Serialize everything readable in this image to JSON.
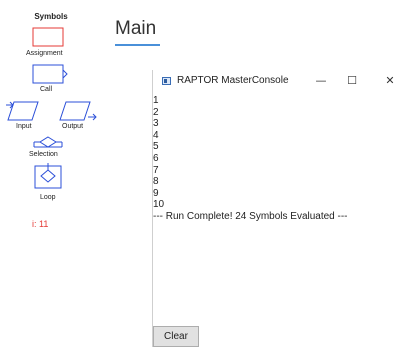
{
  "palette": {
    "title": "Symbols",
    "items": [
      {
        "label": "Assignment",
        "icon": "assignment-rect-icon"
      },
      {
        "label": "Call",
        "icon": "call-arrow-icon"
      },
      {
        "label": "Input",
        "icon": "input-parallelogram-icon"
      },
      {
        "label": "Output",
        "icon": "output-parallelogram-icon"
      },
      {
        "label": "Selection",
        "icon": "selection-diamond-icon"
      },
      {
        "label": "Loop",
        "icon": "loop-diamond-icon"
      }
    ]
  },
  "variables": {
    "readout": "i: 11"
  },
  "main_tab": {
    "label": "Main"
  },
  "console": {
    "title": "RAPTOR MasterConsole",
    "minimize": "—",
    "maximize": "☐",
    "close": "✕",
    "lines": [
      "1",
      "2",
      "3",
      "4",
      "5",
      "6",
      "7",
      "8",
      "9",
      "10",
      "--- Run Complete!  24 Symbols Evaluated ---"
    ],
    "clear_label": "Clear"
  },
  "colors": {
    "assignment_border": "#e53935",
    "symbol_blue": "#2b4fd8",
    "variable_text": "#e53935",
    "tab_underline": "#4a90d9"
  }
}
